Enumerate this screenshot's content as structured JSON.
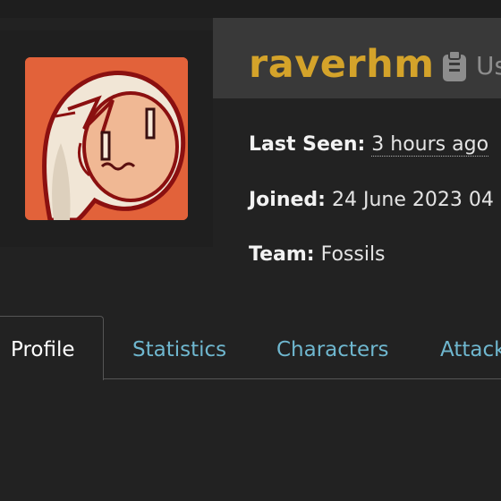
{
  "profile": {
    "username": "raverhm",
    "user_abbrev": "Us",
    "last_seen_label": "Last Seen:",
    "last_seen_value": "3 hours ago",
    "joined_label": "Joined:",
    "joined_value": "24 June 2023 04",
    "team_label": "Team:",
    "team_value": "Fossils"
  },
  "tabs": [
    {
      "label": "Profile"
    },
    {
      "label": "Statistics"
    },
    {
      "label": "Characters"
    },
    {
      "label": "Attack"
    }
  ],
  "icons": {
    "clipboard": "clipboard-icon"
  },
  "colors": {
    "background": "#222222",
    "username": "#d4a32a",
    "tab_link": "#6fb7cf",
    "avatar_bg": "#e2623a"
  }
}
